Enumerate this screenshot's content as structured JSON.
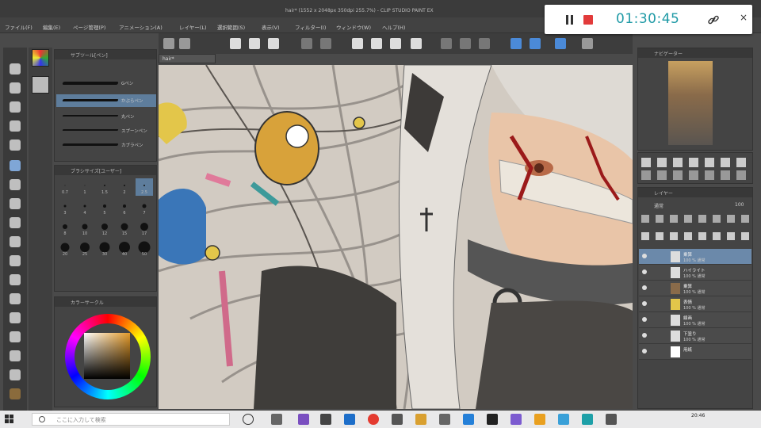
{
  "window": {
    "title": "hair* (1552 x 2048px 350dpi 255.7%) - CLIP STUDIO PAINT EX"
  },
  "menu": {
    "items": [
      "ファイル(F)",
      "編集(E)",
      "ページ管理(P)",
      "アニメーション(A)",
      "レイヤー(L)",
      "選択範囲(S)",
      "表示(V)",
      "フィルター(I)",
      "ウィンドウ(W)",
      "ヘルプ(H)"
    ]
  },
  "recorder": {
    "time": "01:30:45",
    "icons": [
      "pause-icon",
      "stop-icon",
      "link-icon",
      "close-icon"
    ],
    "close_glyph": "×",
    "stop_color": "#e23b3b",
    "time_color": "#1f9aa6"
  },
  "document": {
    "tab_label": "hair*"
  },
  "brush_panel": {
    "title": "サブツール[ペン]",
    "brushes": [
      "Gペン",
      "かぶらペン",
      "丸ペン",
      "スプーンペン",
      "カブラペン"
    ]
  },
  "brush_size_panel": {
    "title": "ブラシサイズ[ユーザー]",
    "sizes": [
      "0.7",
      "1",
      "1.5",
      "2",
      "2.5",
      "3",
      "4",
      "5",
      "6",
      "7",
      "8",
      "10",
      "12",
      "15",
      "17",
      "20",
      "25",
      "30",
      "40",
      "50"
    ]
  },
  "color_panel": {
    "title": "カラーサークル",
    "current_color": "#e39a2a"
  },
  "navigator": {
    "title": "ナビゲーター"
  },
  "layer_panel": {
    "title": "レイヤー",
    "blend_mode": "通常",
    "opacity": "100",
    "layers": [
      {
        "name": "乗算",
        "meta": "100 % 通常"
      },
      {
        "name": "ハイライト",
        "meta": "100 % 通常"
      },
      {
        "name": "乗算",
        "meta": "100 % 通常"
      },
      {
        "name": "表情",
        "meta": "100 % 通常"
      },
      {
        "name": "線画",
        "meta": "100 % 通常"
      },
      {
        "name": "下塗り",
        "meta": "100 % 通常"
      },
      {
        "name": "用紙",
        "meta": ""
      }
    ]
  },
  "taskbar": {
    "search_placeholder": "ここに入力して検索",
    "time": "20:46"
  }
}
